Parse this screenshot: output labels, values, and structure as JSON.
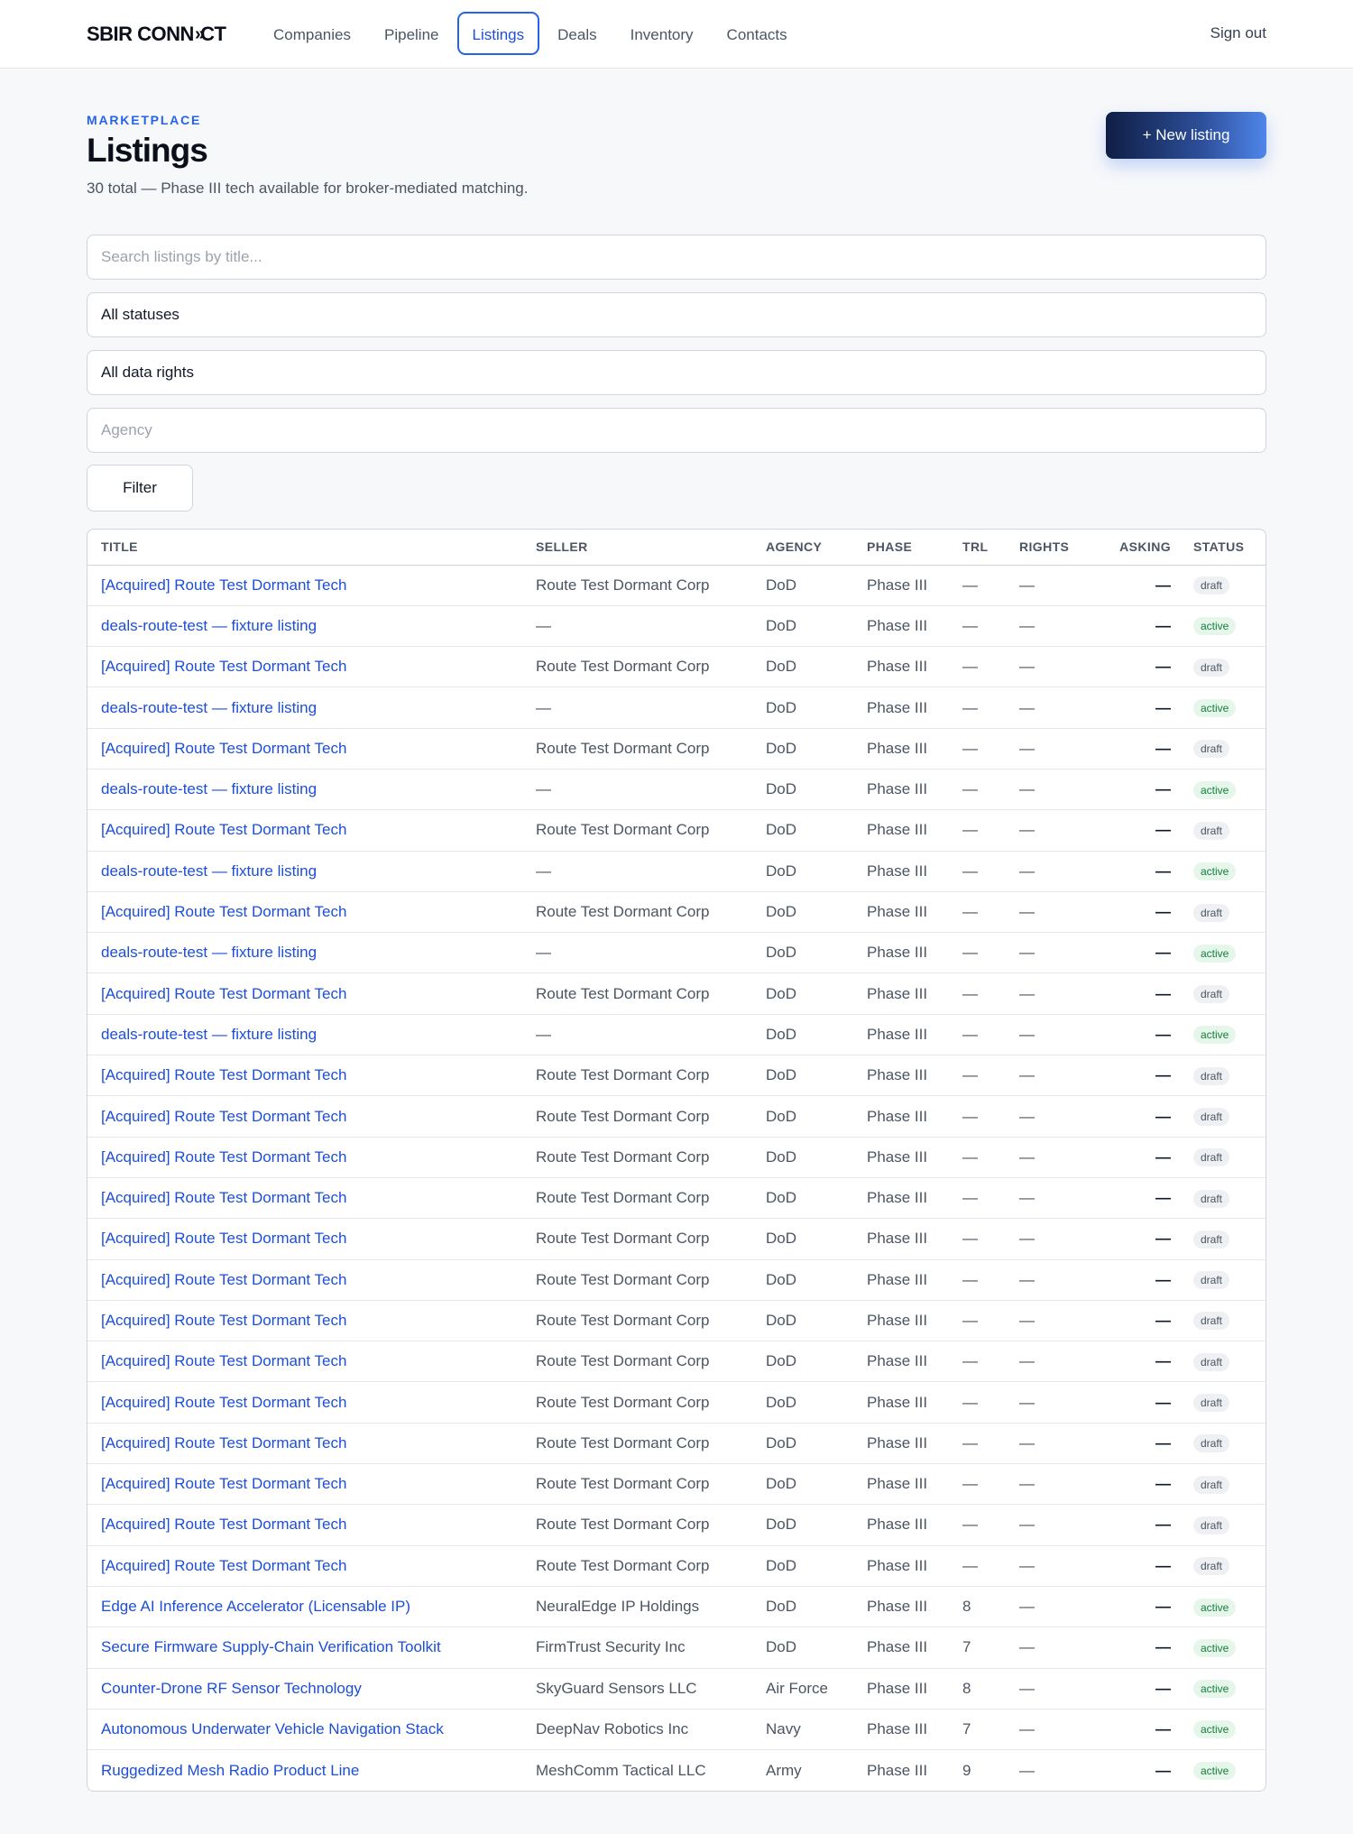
{
  "app": {
    "logo_pre": "SBIR CONN",
    "logo_mark": "»",
    "logo_post": "CT",
    "nav": [
      "Companies",
      "Pipeline",
      "Listings",
      "Deals",
      "Inventory",
      "Contacts"
    ],
    "active_nav": "Listings",
    "sign_out": "Sign out"
  },
  "header": {
    "eyebrow": "MARKETPLACE",
    "title": "Listings",
    "subtitle": "30 total — Phase III tech available for broker-mediated matching.",
    "new_button": "+ New listing"
  },
  "filters": {
    "search_placeholder": "Search listings by title...",
    "status_value": "All statuses",
    "rights_value": "All data rights",
    "agency_placeholder": "Agency",
    "filter_button": "Filter"
  },
  "table": {
    "columns": [
      "TITLE",
      "SELLER",
      "AGENCY",
      "PHASE",
      "TRL",
      "RIGHTS",
      "ASKING",
      "STATUS"
    ],
    "rows": [
      [
        "[Acquired] Route Test Dormant Tech",
        "Route Test Dormant Corp",
        "DoD",
        "Phase III",
        "—",
        "—",
        "—",
        "draft"
      ],
      [
        "deals-route-test — fixture listing",
        "—",
        "DoD",
        "Phase III",
        "—",
        "—",
        "—",
        "active"
      ],
      [
        "[Acquired] Route Test Dormant Tech",
        "Route Test Dormant Corp",
        "DoD",
        "Phase III",
        "—",
        "—",
        "—",
        "draft"
      ],
      [
        "deals-route-test — fixture listing",
        "—",
        "DoD",
        "Phase III",
        "—",
        "—",
        "—",
        "active"
      ],
      [
        "[Acquired] Route Test Dormant Tech",
        "Route Test Dormant Corp",
        "DoD",
        "Phase III",
        "—",
        "—",
        "—",
        "draft"
      ],
      [
        "deals-route-test — fixture listing",
        "—",
        "DoD",
        "Phase III",
        "—",
        "—",
        "—",
        "active"
      ],
      [
        "[Acquired] Route Test Dormant Tech",
        "Route Test Dormant Corp",
        "DoD",
        "Phase III",
        "—",
        "—",
        "—",
        "draft"
      ],
      [
        "deals-route-test — fixture listing",
        "—",
        "DoD",
        "Phase III",
        "—",
        "—",
        "—",
        "active"
      ],
      [
        "[Acquired] Route Test Dormant Tech",
        "Route Test Dormant Corp",
        "DoD",
        "Phase III",
        "—",
        "—",
        "—",
        "draft"
      ],
      [
        "deals-route-test — fixture listing",
        "—",
        "DoD",
        "Phase III",
        "—",
        "—",
        "—",
        "active"
      ],
      [
        "[Acquired] Route Test Dormant Tech",
        "Route Test Dormant Corp",
        "DoD",
        "Phase III",
        "—",
        "—",
        "—",
        "draft"
      ],
      [
        "deals-route-test — fixture listing",
        "—",
        "DoD",
        "Phase III",
        "—",
        "—",
        "—",
        "active"
      ],
      [
        "[Acquired] Route Test Dormant Tech",
        "Route Test Dormant Corp",
        "DoD",
        "Phase III",
        "—",
        "—",
        "—",
        "draft"
      ],
      [
        "[Acquired] Route Test Dormant Tech",
        "Route Test Dormant Corp",
        "DoD",
        "Phase III",
        "—",
        "—",
        "—",
        "draft"
      ],
      [
        "[Acquired] Route Test Dormant Tech",
        "Route Test Dormant Corp",
        "DoD",
        "Phase III",
        "—",
        "—",
        "—",
        "draft"
      ],
      [
        "[Acquired] Route Test Dormant Tech",
        "Route Test Dormant Corp",
        "DoD",
        "Phase III",
        "—",
        "—",
        "—",
        "draft"
      ],
      [
        "[Acquired] Route Test Dormant Tech",
        "Route Test Dormant Corp",
        "DoD",
        "Phase III",
        "—",
        "—",
        "—",
        "draft"
      ],
      [
        "[Acquired] Route Test Dormant Tech",
        "Route Test Dormant Corp",
        "DoD",
        "Phase III",
        "—",
        "—",
        "—",
        "draft"
      ],
      [
        "[Acquired] Route Test Dormant Tech",
        "Route Test Dormant Corp",
        "DoD",
        "Phase III",
        "—",
        "—",
        "—",
        "draft"
      ],
      [
        "[Acquired] Route Test Dormant Tech",
        "Route Test Dormant Corp",
        "DoD",
        "Phase III",
        "—",
        "—",
        "—",
        "draft"
      ],
      [
        "[Acquired] Route Test Dormant Tech",
        "Route Test Dormant Corp",
        "DoD",
        "Phase III",
        "—",
        "—",
        "—",
        "draft"
      ],
      [
        "[Acquired] Route Test Dormant Tech",
        "Route Test Dormant Corp",
        "DoD",
        "Phase III",
        "—",
        "—",
        "—",
        "draft"
      ],
      [
        "[Acquired] Route Test Dormant Tech",
        "Route Test Dormant Corp",
        "DoD",
        "Phase III",
        "—",
        "—",
        "—",
        "draft"
      ],
      [
        "[Acquired] Route Test Dormant Tech",
        "Route Test Dormant Corp",
        "DoD",
        "Phase III",
        "—",
        "—",
        "—",
        "draft"
      ],
      [
        "[Acquired] Route Test Dormant Tech",
        "Route Test Dormant Corp",
        "DoD",
        "Phase III",
        "—",
        "—",
        "—",
        "draft"
      ],
      [
        "Edge AI Inference Accelerator (Licensable IP)",
        "NeuralEdge IP Holdings",
        "DoD",
        "Phase III",
        "8",
        "—",
        "—",
        "active"
      ],
      [
        "Secure Firmware Supply-Chain Verification Toolkit",
        "FirmTrust Security Inc",
        "DoD",
        "Phase III",
        "7",
        "—",
        "—",
        "active"
      ],
      [
        "Counter-Drone RF Sensor Technology",
        "SkyGuard Sensors LLC",
        "Air Force",
        "Phase III",
        "8",
        "—",
        "—",
        "active"
      ],
      [
        "Autonomous Underwater Vehicle Navigation Stack",
        "DeepNav Robotics Inc",
        "Navy",
        "Phase III",
        "7",
        "—",
        "—",
        "active"
      ],
      [
        "Ruggedized Mesh Radio Product Line",
        "MeshComm Tactical LLC",
        "Army",
        "Phase III",
        "9",
        "—",
        "—",
        "active"
      ]
    ]
  }
}
